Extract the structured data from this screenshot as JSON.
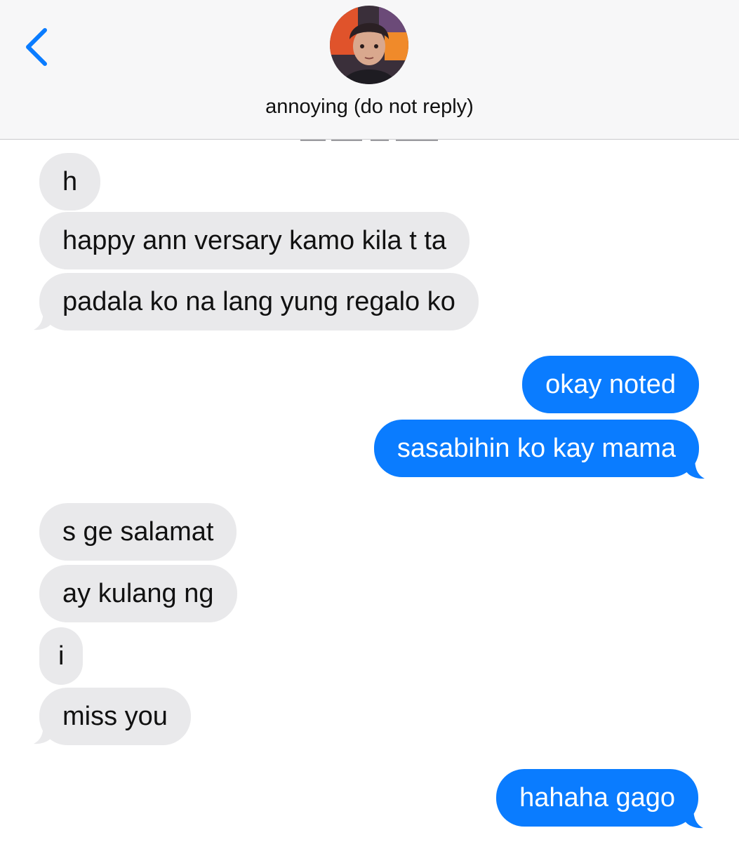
{
  "header": {
    "contact_name": "annoying (do not reply)",
    "back_icon": "chevron-left-icon",
    "avatar": "contact-avatar"
  },
  "colors": {
    "sent_bubble": "#0a7cff",
    "received_bubble": "#e9e9eb",
    "header_bg": "#f7f7f8",
    "accent": "#0a7cff"
  },
  "messages": [
    {
      "from": "them",
      "text": "h"
    },
    {
      "from": "them",
      "text": "happy ann versary kamo kila t ta"
    },
    {
      "from": "them",
      "text": "padala ko na lang yung regalo ko"
    },
    {
      "from": "me",
      "text": "okay noted"
    },
    {
      "from": "me",
      "text": "sasabihin ko kay mama"
    },
    {
      "from": "them",
      "text": "s ge salamat"
    },
    {
      "from": "them",
      "text": "ay kulang ng"
    },
    {
      "from": "them",
      "text": "i"
    },
    {
      "from": "them",
      "text": "miss you"
    },
    {
      "from": "me",
      "text": "hahaha gago"
    }
  ]
}
